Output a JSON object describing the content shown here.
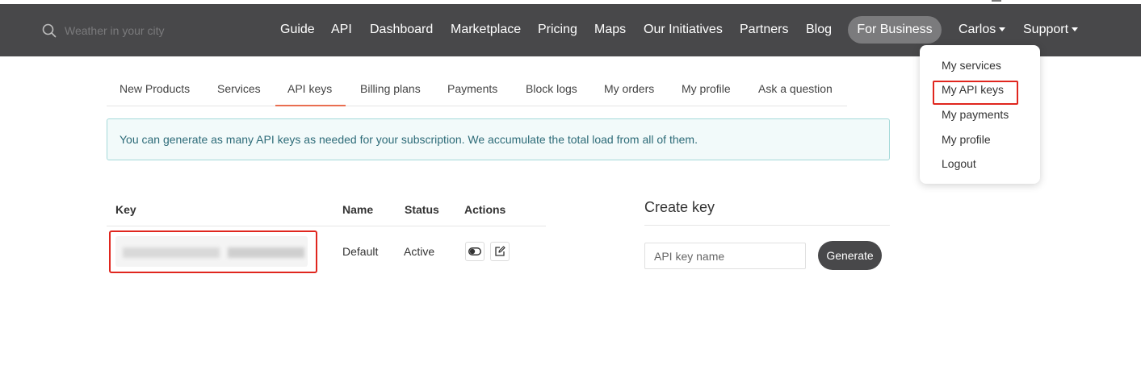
{
  "search": {
    "placeholder": "Weather in your city"
  },
  "nav": {
    "items": [
      "Guide",
      "API",
      "Dashboard",
      "Marketplace",
      "Pricing",
      "Maps",
      "Our Initiatives",
      "Partners",
      "Blog"
    ],
    "for_business": "For Business",
    "user": "Carlos",
    "support": "Support"
  },
  "user_menu": {
    "items": [
      "My services",
      "My API keys",
      "My payments",
      "My profile",
      "Logout"
    ],
    "highlighted": "My API keys"
  },
  "tabs": {
    "items": [
      "New Products",
      "Services",
      "API keys",
      "Billing plans",
      "Payments",
      "Block logs",
      "My orders",
      "My profile",
      "Ask a question"
    ],
    "active": "API keys"
  },
  "alert": {
    "text": "You can generate as many API keys as needed for your subscription. We accumulate the total load from all of them."
  },
  "keys_table": {
    "headers": {
      "key": "Key",
      "name": "Name",
      "status": "Status",
      "actions": "Actions"
    },
    "rows": [
      {
        "key": "",
        "name": "Default",
        "status": "Active"
      }
    ]
  },
  "create_key": {
    "title": "Create key",
    "input_placeholder": "API key name",
    "button": "Generate"
  },
  "colors": {
    "topbar": "#48484a",
    "pill": "#7b7b7d",
    "tab_underline": "#e96e50",
    "highlight_box": "#e0261e",
    "alert_bg": "#f2fafa",
    "alert_text": "#2d6b78"
  }
}
